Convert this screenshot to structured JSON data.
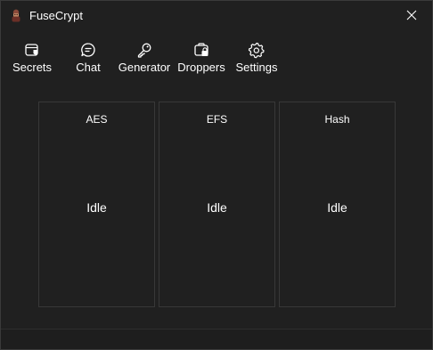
{
  "window": {
    "title": "FuseCrypt",
    "app_icon": "fusecrypt-logo-icon",
    "close_icon": "close-icon"
  },
  "toolbar": {
    "items": [
      {
        "label": "Secrets",
        "icon": "secrets-safe-icon"
      },
      {
        "label": "Chat",
        "icon": "chat-bubble-icon"
      },
      {
        "label": "Generator",
        "icon": "key-icon"
      },
      {
        "label": "Droppers",
        "icon": "briefcase-lock-icon"
      },
      {
        "label": "Settings",
        "icon": "gear-icon"
      }
    ]
  },
  "panels": [
    {
      "title": "AES",
      "status": "Idle"
    },
    {
      "title": "EFS",
      "status": "Idle"
    },
    {
      "title": "Hash",
      "status": "Idle"
    }
  ],
  "colors": {
    "background": "#202020",
    "panel_border": "#383838",
    "text": "#ffffff"
  }
}
